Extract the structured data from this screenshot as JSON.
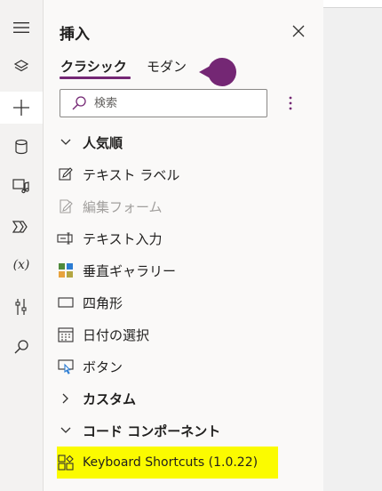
{
  "rail": {
    "items": [
      {
        "name": "hamburger-icon"
      },
      {
        "name": "layers-icon"
      },
      {
        "name": "plus-icon"
      },
      {
        "name": "data-icon"
      },
      {
        "name": "media-icon"
      },
      {
        "name": "flows-icon"
      },
      {
        "name": "variables-icon",
        "label": "(x)"
      },
      {
        "name": "tools-icon"
      },
      {
        "name": "search-icon"
      }
    ]
  },
  "panel": {
    "title": "挿入",
    "close_icon": "close-icon",
    "tabs": [
      {
        "label": "クラシック",
        "active": true
      },
      {
        "label": "モダン",
        "active": false
      }
    ],
    "search": {
      "placeholder": "検索",
      "value": ""
    },
    "more_icon": "more-vertical-icon",
    "accent_color": "#742774",
    "items": [
      {
        "type": "section",
        "expanded": true,
        "label": "人気順"
      },
      {
        "type": "item",
        "label": "テキスト ラベル",
        "icon": "edit-icon"
      },
      {
        "type": "item",
        "label": "編集フォーム",
        "icon": "edit-form-icon",
        "disabled": true
      },
      {
        "type": "item",
        "label": "テキスト入力",
        "icon": "text-input-icon"
      },
      {
        "type": "item",
        "label": "垂直ギャラリー",
        "icon": "gallery-icon"
      },
      {
        "type": "item",
        "label": "四角形",
        "icon": "rectangle-icon"
      },
      {
        "type": "item",
        "label": "日付の選択",
        "icon": "calendar-icon"
      },
      {
        "type": "item",
        "label": "ボタン",
        "icon": "button-icon"
      },
      {
        "type": "section",
        "expanded": false,
        "label": "カスタム"
      },
      {
        "type": "section",
        "expanded": true,
        "label": "コード コンポーネント"
      },
      {
        "type": "item",
        "label": "Keyboard Shortcuts (1.0.22)",
        "icon": "component-icon",
        "highlight_color": "#fbfb00"
      }
    ]
  }
}
